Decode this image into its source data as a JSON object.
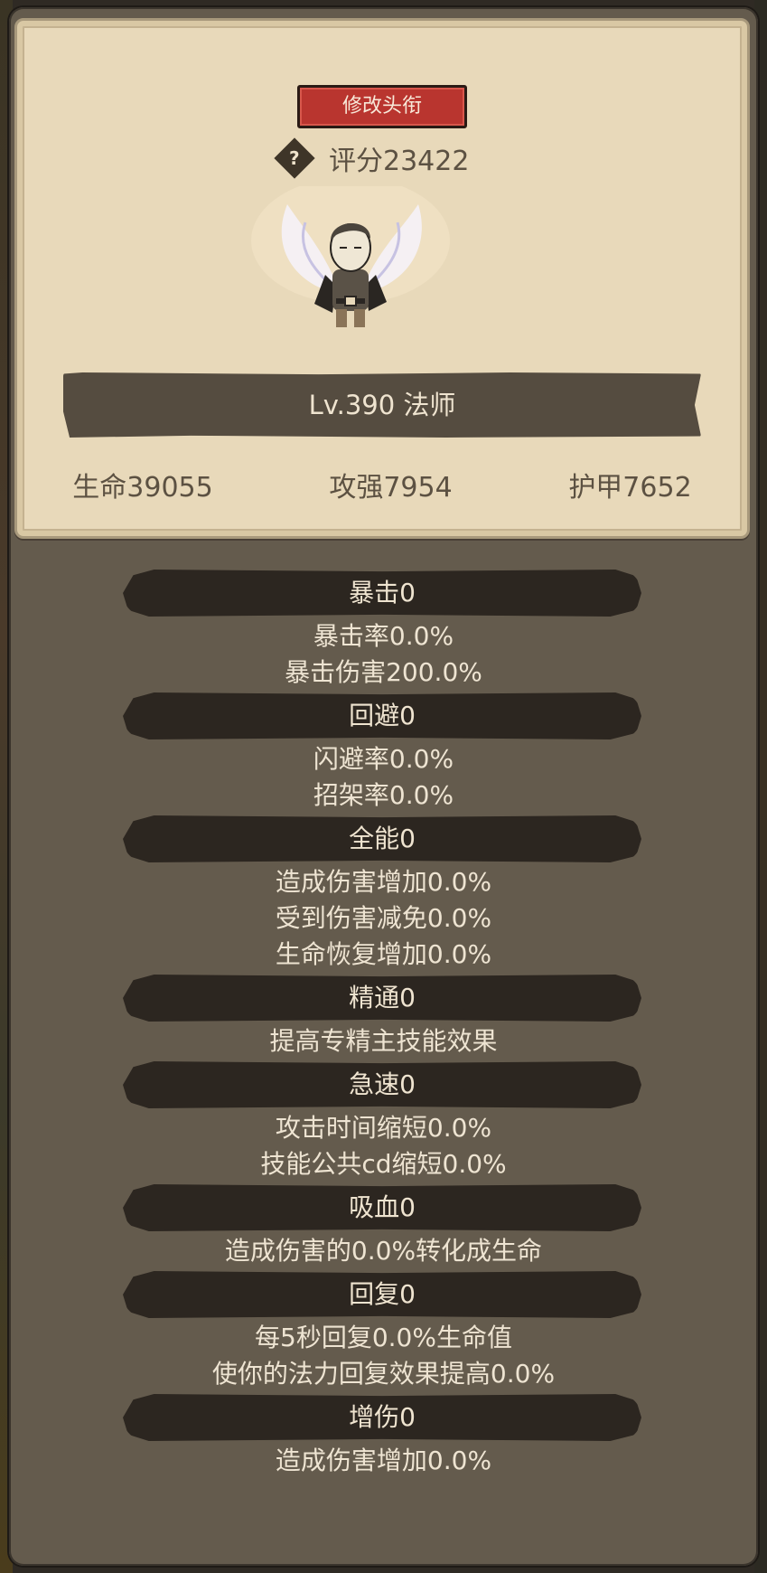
{
  "header": {
    "title_button": "修改头衔",
    "help_icon": "?",
    "score": "评分23422"
  },
  "character": {
    "level_class": "Lv.390 法师"
  },
  "stats": [
    {
      "label": "生命39055"
    },
    {
      "label": "攻强7954"
    },
    {
      "label": "护甲7652"
    }
  ],
  "sections": [
    {
      "title": "暴击0",
      "lines": [
        "暴击率0.0%",
        "暴击伤害200.0%"
      ]
    },
    {
      "title": "回避0",
      "lines": [
        "闪避率0.0%",
        "招架率0.0%"
      ]
    },
    {
      "title": "全能0",
      "lines": [
        "造成伤害增加0.0%",
        "受到伤害减免0.0%",
        "生命恢复增加0.0%"
      ]
    },
    {
      "title": "精通0",
      "lines": [
        "提高专精主技能效果"
      ]
    },
    {
      "title": "急速0",
      "lines": [
        "攻击时间缩短0.0%",
        "技能公共cd缩短0.0%"
      ]
    },
    {
      "title": "吸血0",
      "lines": [
        "造成伤害的0.0%转化成生命"
      ]
    },
    {
      "title": "回复0",
      "lines": [
        "每5秒回复0.0%生命值",
        "使你的法力回复效果提高0.0%"
      ]
    },
    {
      "title": "增伤0",
      "lines": [
        "造成伤害增加0.0%"
      ]
    }
  ]
}
